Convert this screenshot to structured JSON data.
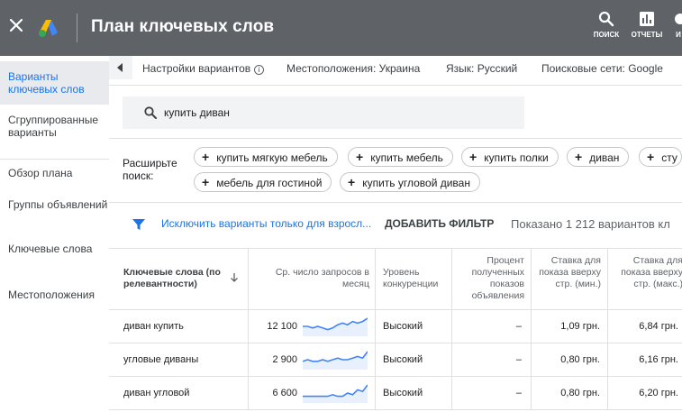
{
  "header": {
    "title": "План ключевых слов",
    "tools": [
      {
        "label": "ПОИСК",
        "icon": "search-icon"
      },
      {
        "label": "ОТЧЕТЫ",
        "icon": "reports-icon"
      },
      {
        "label": "И",
        "icon": "tools-icon"
      }
    ]
  },
  "sidebar": {
    "items": [
      {
        "label": "Варианты ключевых слов",
        "active": true
      },
      {
        "label": "Сгруппированные варианты"
      },
      {
        "label": "Обзор плана"
      },
      {
        "label": "Группы объявлений"
      },
      {
        "label": "Ключевые слова"
      },
      {
        "label": "Местоположения"
      }
    ]
  },
  "settings": {
    "label": "Настройки вариантов",
    "location": "Местоположения: Украина",
    "language": "Язык: Русский",
    "network": "Поисковые сети: Google"
  },
  "search": {
    "query": "купить диван"
  },
  "expand": {
    "label": "Расширьте поиск:",
    "chips": [
      "купить мягкую мебель",
      "купить мебель",
      "купить полки",
      "диван",
      "сту",
      "мебель для гостиной",
      "купить угловой диван"
    ]
  },
  "filter": {
    "exclude_link": "Исключить варианты только для взросл...",
    "add_filter": "ДОБАВИТЬ ФИЛЬТР",
    "shown": "Показано 1 212 вариантов кл"
  },
  "table": {
    "headers": {
      "keyword": "Ключевые слова (по релевантности)",
      "searches": "Ср. число запросов в месяц",
      "competition": "Уровень конкуренции",
      "impr_share": "Процент полученных показов объявления",
      "bid_low": "Ставка для показа вверху стр. (мин.)",
      "bid_high": "Ставка для показа вверху стр. (макс.)"
    },
    "rows": [
      {
        "keyword": "диван купить",
        "searches": "12 100",
        "trend": [
          5,
          5,
          4,
          5,
          4,
          3,
          4,
          6,
          7,
          6,
          8,
          7,
          8,
          10
        ],
        "competition": "Высокий",
        "impr_share": "–",
        "bid_low": "1,09 грн.",
        "bid_high": "6,84 грн."
      },
      {
        "keyword": "угловые диваны",
        "searches": "2 900",
        "trend": [
          4,
          5,
          4,
          4,
          5,
          4,
          5,
          6,
          5,
          5,
          6,
          7,
          6,
          10
        ],
        "competition": "Высокий",
        "impr_share": "–",
        "bid_low": "0,80 грн.",
        "bid_high": "6,16 грн."
      },
      {
        "keyword": "диван угловой",
        "searches": "6 600",
        "trend": [
          3,
          3,
          3,
          3,
          3,
          3,
          4,
          3,
          3,
          5,
          4,
          7,
          6,
          10
        ],
        "competition": "Высокий",
        "impr_share": "–",
        "bid_low": "0,80 грн.",
        "bid_high": "6,20 грн."
      }
    ]
  },
  "colors": {
    "topbar": "#5f6368",
    "accent": "#1a73e8",
    "sparkline": "#4285f4",
    "sparkline_fill": "#e8f0fe"
  }
}
